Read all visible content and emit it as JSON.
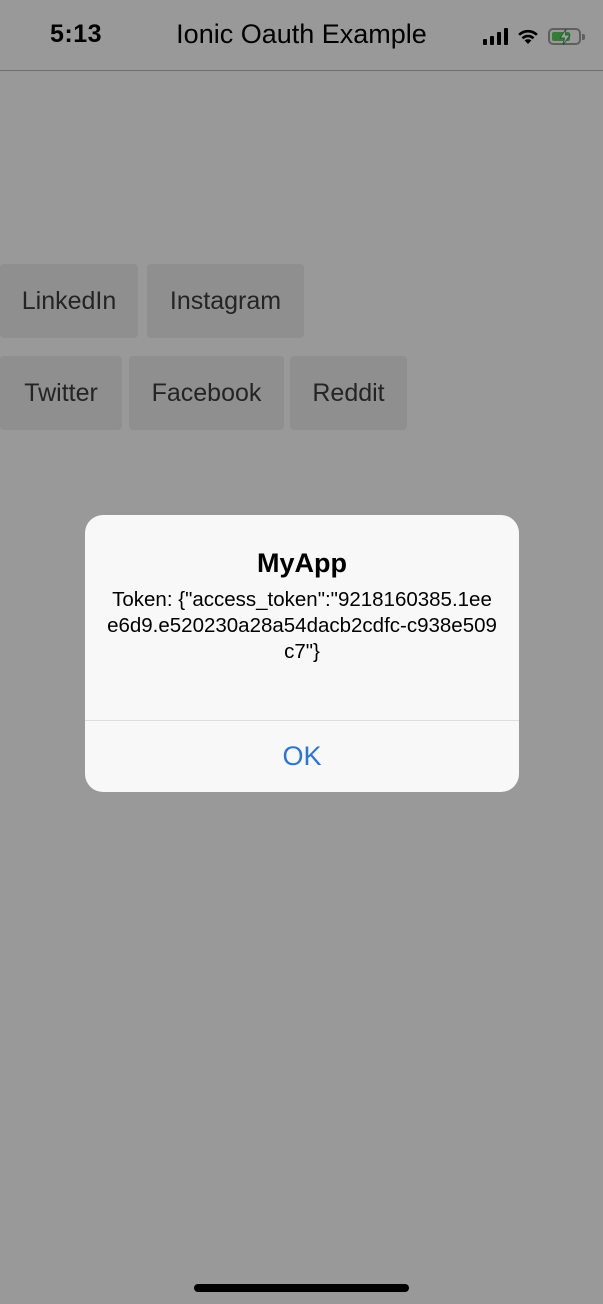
{
  "status_bar": {
    "time": "5:13",
    "icons": [
      "cellular-signal-icon",
      "wifi-icon",
      "battery-charging-icon"
    ],
    "battery_color": "#55c95a"
  },
  "header": {
    "title": "Ionic Oauth Example"
  },
  "buttons": {
    "linkedin": "LinkedIn",
    "instagram": "Instagram",
    "twitter": "Twitter",
    "facebook": "Facebook",
    "reddit": "Reddit"
  },
  "alert": {
    "title": "MyApp",
    "message": "Token: {\"access_token\":\"9218160385.1eee6d9.e520230a28a54dacb2cdfc-c938e509c7\"}",
    "ok_label": "OK",
    "ok_color": "#2a76d8"
  }
}
